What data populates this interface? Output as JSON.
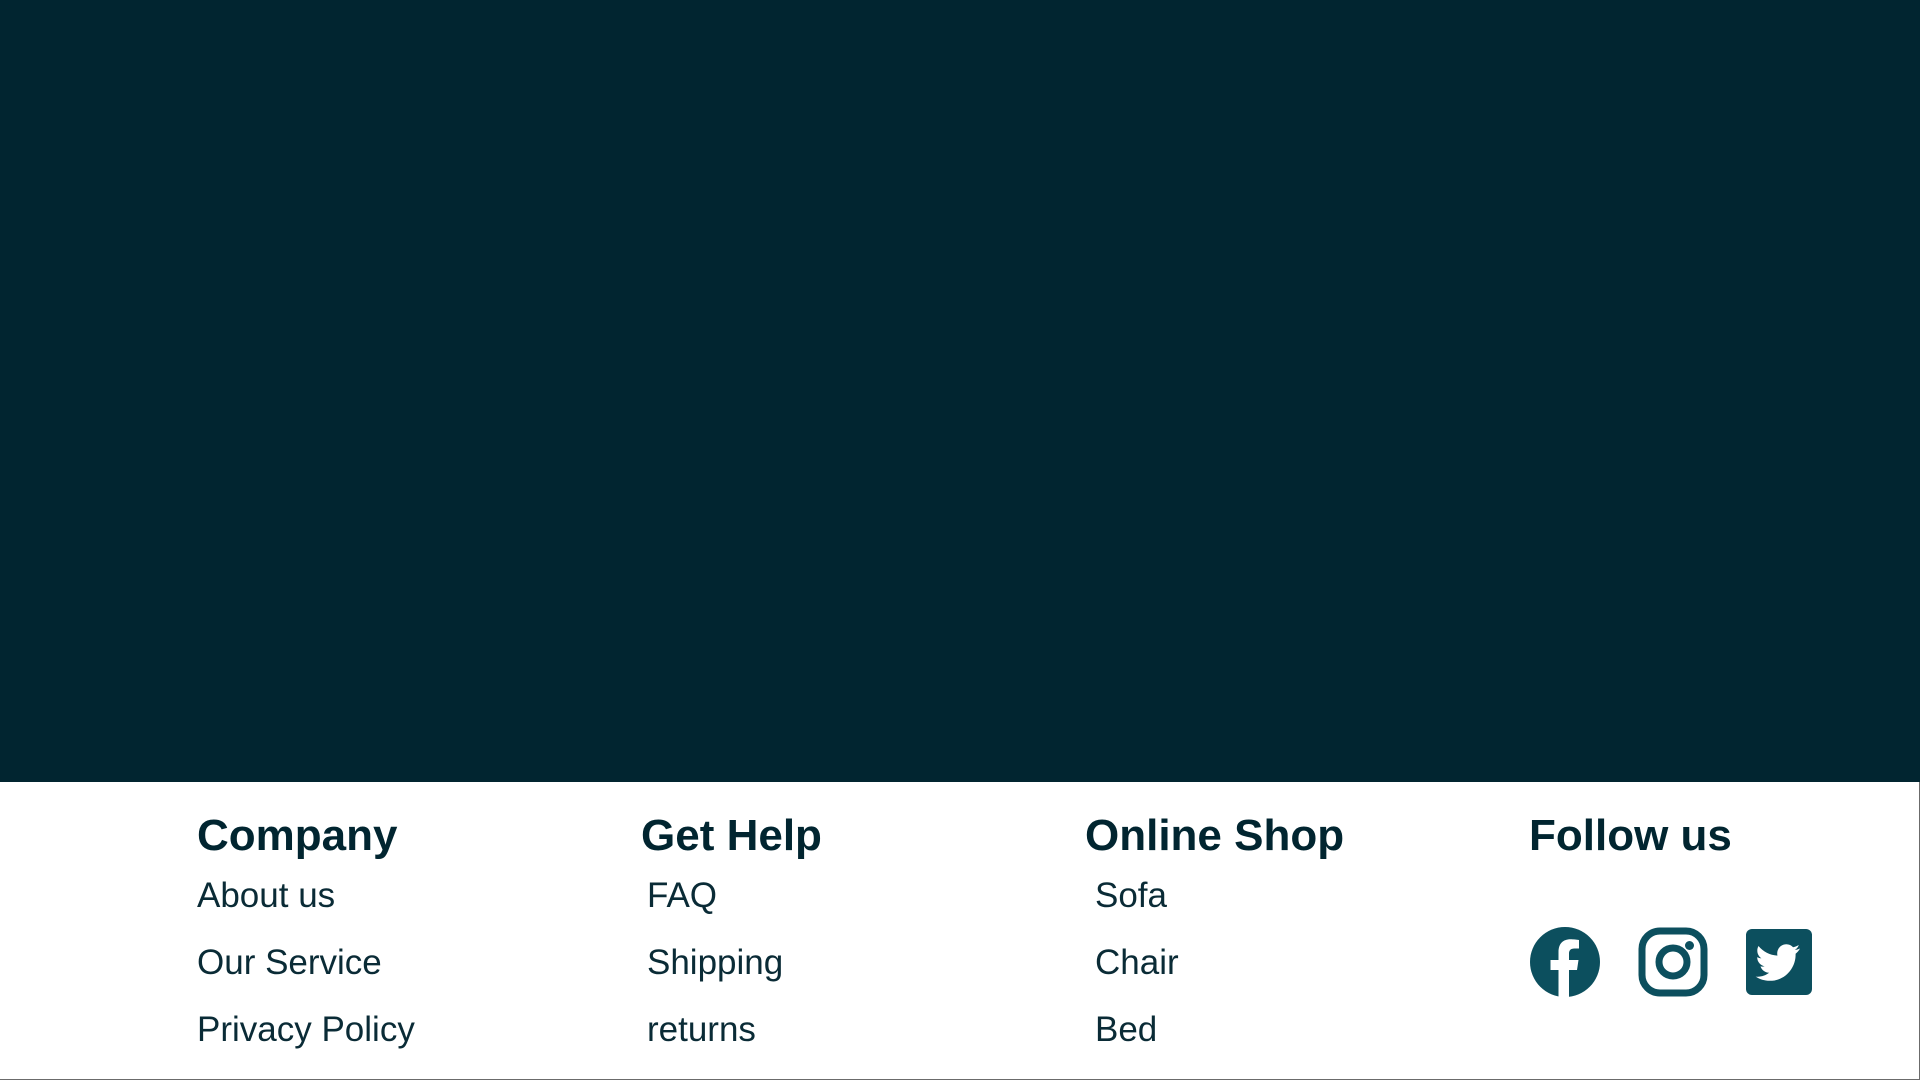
{
  "colors": {
    "hero_background": "#012530",
    "text": "#012530",
    "icon": "#0c4f5e",
    "footer_background": "#ffffff"
  },
  "footer": {
    "company": {
      "heading": "Company",
      "links": [
        "About us",
        "Our Service",
        "Privacy Policy"
      ]
    },
    "help": {
      "heading": "Get Help",
      "links": [
        "FAQ",
        "Shipping",
        "returns"
      ]
    },
    "shop": {
      "heading": "Online Shop",
      "links": [
        "Sofa",
        "Chair",
        "Bed"
      ]
    },
    "follow": {
      "heading": "Follow us",
      "icons": [
        "facebook-icon",
        "instagram-icon",
        "twitter-icon"
      ]
    }
  }
}
